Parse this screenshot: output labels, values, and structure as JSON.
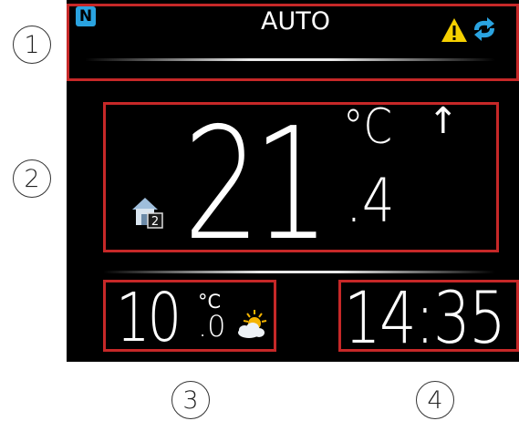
{
  "top_bar": {
    "mode_label": "AUTO",
    "n_badge": "N",
    "warning_icon": "warning-triangle-icon",
    "sync_icon": "sync-icon"
  },
  "main": {
    "temperature_integer": "21",
    "temperature_unit": "°C",
    "temperature_decimal": ".4",
    "trend_arrow": "↑",
    "zone_icon": "home-zone-icon",
    "zone_number": "2"
  },
  "outdoor": {
    "temperature_integer": "10",
    "temperature_unit": "°C",
    "temperature_decimal": ".0",
    "weather_icon": "partly-cloudy-icon"
  },
  "clock": {
    "time": "14:35"
  },
  "callouts": [
    "1",
    "2",
    "3",
    "4"
  ],
  "colors": {
    "frame": "#c62828",
    "screen_bg": "#000000",
    "badge_blue": "#2aa3e0",
    "warning_yellow": "#f5d000",
    "text": "#ffffff"
  }
}
